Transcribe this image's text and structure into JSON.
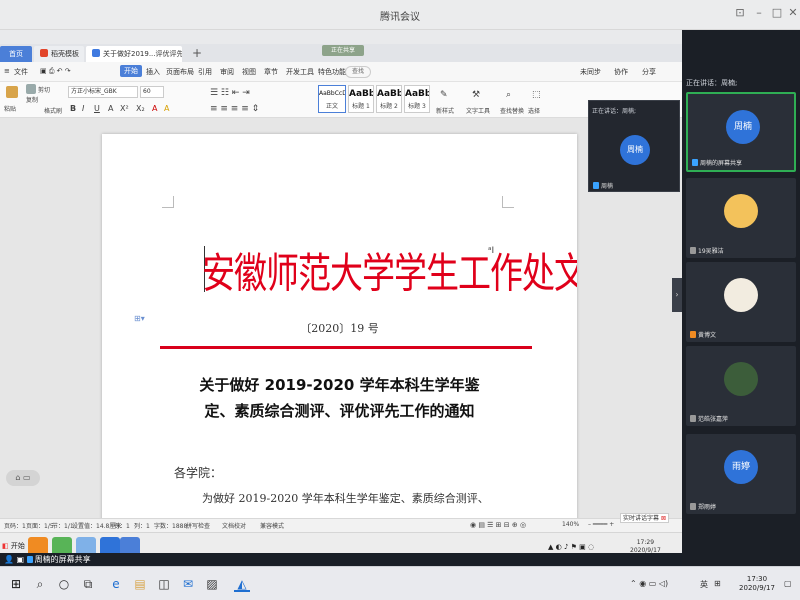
{
  "meeting": {
    "title": "腾讯会议"
  },
  "wps": {
    "tabs": [
      "首页",
      "稻壳模板",
      "关于做好2019...评优评先工作的通知"
    ],
    "share_badge": "正在共享",
    "menus": [
      "文件",
      "开始",
      "插入",
      "页面布局",
      "引用",
      "审阅",
      "视图",
      "章节",
      "开发工具",
      "特色功能"
    ],
    "search": "查找",
    "right_menus": [
      "未同步",
      "协作",
      "分享"
    ],
    "ribbon": {
      "paste": "粘贴",
      "cut": "剪切",
      "copy": "复制",
      "format_painter": "格式刷",
      "font_name": "方正小标宋_GBK",
      "font_size": "60",
      "styles": [
        {
          "sample": "AaBbCcDd",
          "label": "正文"
        },
        {
          "sample": "AaBb",
          "label": "标题 1"
        },
        {
          "sample": "AaBb(",
          "label": "标题 2"
        },
        {
          "sample": "AaBbC",
          "label": "标题 3"
        }
      ],
      "new_style": "新样式",
      "text_tools": "文字工具",
      "find_replace": "查找替换",
      "select": "选择"
    }
  },
  "document": {
    "header_title": "安徽师范大学学生工作处文件",
    "doc_number": "〔2020〕19 号",
    "notice_title": [
      "关于做好 2019-2020 学年本科生学年鉴",
      "定、素质综合测评、评优评先工作的通知"
    ],
    "salutation": "各学院：",
    "body": "为做好 2019-2020 学年本科生学年鉴定、素质综合测评、"
  },
  "statusbar": {
    "items": [
      "页码：1",
      "页面：1/5",
      "节：1/1",
      "设置值：14.8厘米",
      "行：1",
      "列：1",
      "字数：1888",
      "拼写检查",
      "文档校对",
      "兼容模式"
    ],
    "zoom": "140%"
  },
  "subtitle_btn": "实时讲话字幕",
  "remote_taskbar": {
    "start": "开始",
    "time": "17:29",
    "date": "2020/9/17"
  },
  "share_label": "周楠的屏幕共享",
  "float_speaker": {
    "header": "正在讲话：周楠;",
    "avatar": "周楠",
    "name": "周楠"
  },
  "video_panel": {
    "speaking": "正在讲话：周楠;",
    "participants": [
      {
        "avatar": "周楠",
        "name": "周楠的屏幕共享",
        "color": "#2f73d9"
      },
      {
        "avatar": "",
        "name": "19吴雅洁",
        "color": "#f3c25b"
      },
      {
        "avatar": "",
        "name": "黄博文",
        "color": "#f2ece0"
      },
      {
        "avatar": "",
        "name": "范皓张嘉萍",
        "color": "#3c5d3a"
      },
      {
        "avatar": "雨婷",
        "name": "郑雨婷",
        "color": "#2f73d9"
      }
    ]
  },
  "windows": {
    "tray_lang": "英",
    "time": "17:30",
    "date": "2020/9/17"
  }
}
